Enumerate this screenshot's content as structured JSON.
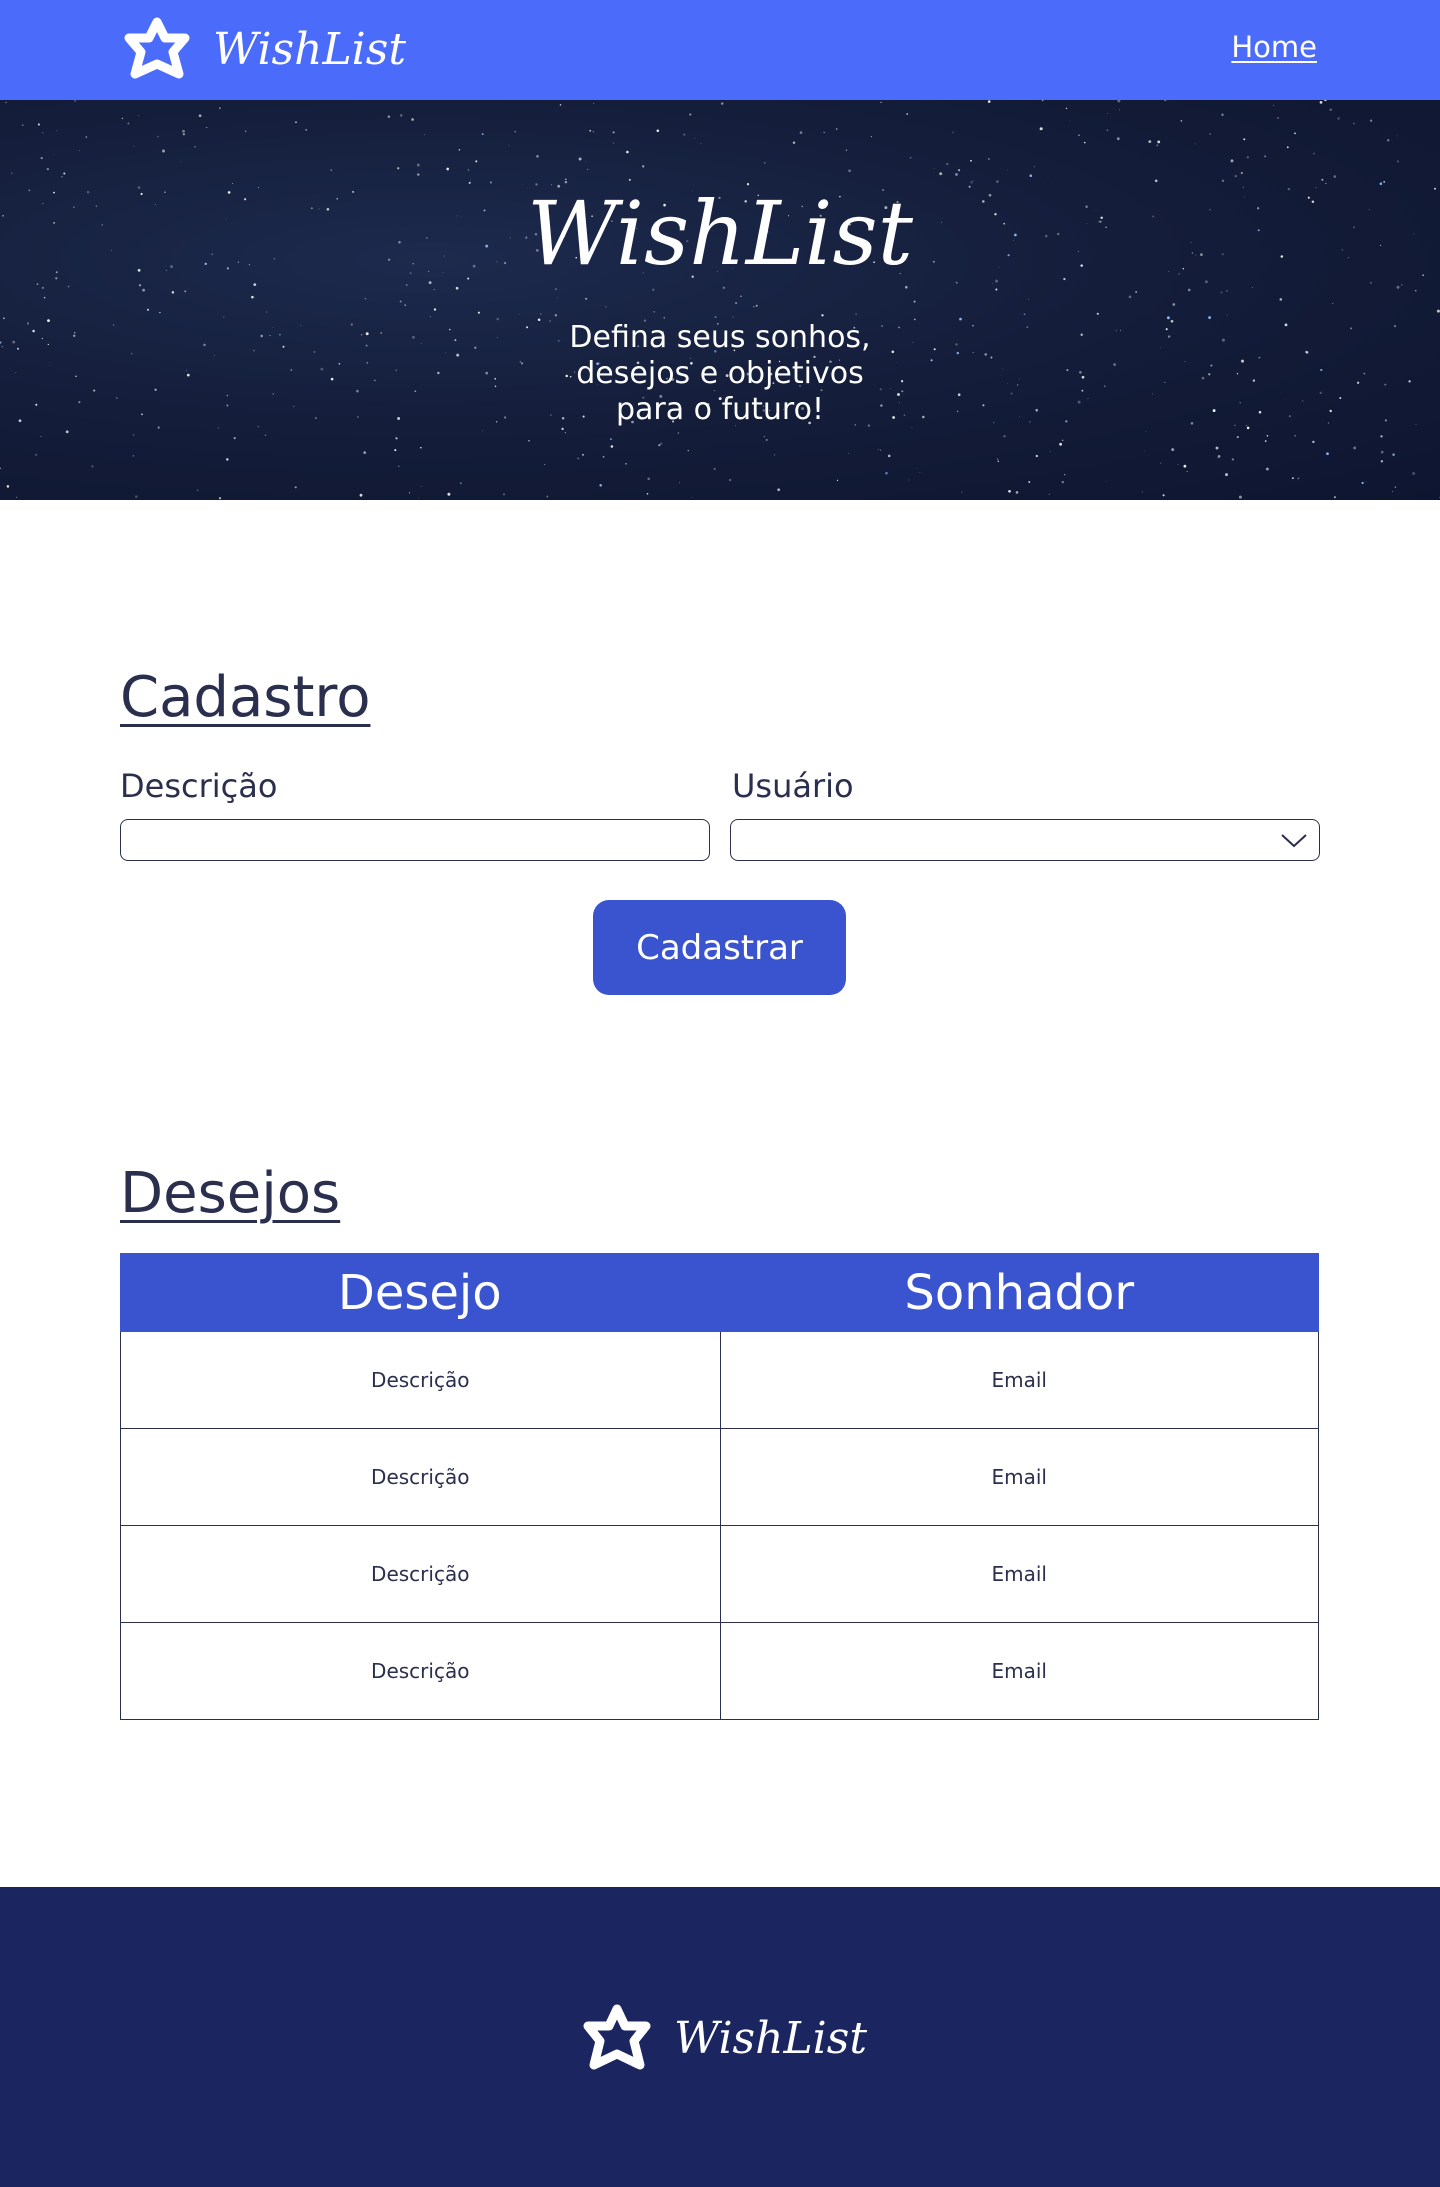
{
  "header": {
    "brand": "WishList",
    "nav_home": "Home"
  },
  "hero": {
    "title": "WishList",
    "subtitle_lines": [
      "Defina seus sonhos,",
      "desejos e objetivos",
      "para o futuro!"
    ]
  },
  "cadastro": {
    "title": "Cadastro",
    "descricao_label": "Descrição",
    "descricao_value": "",
    "usuario_label": "Usuário",
    "usuario_value": "",
    "submit_label": "Cadastrar"
  },
  "desejos": {
    "title": "Desejos",
    "columns": [
      "Desejo",
      "Sonhador"
    ],
    "rows": [
      [
        "Descrição",
        "Email"
      ],
      [
        "Descrição",
        "Email"
      ],
      [
        "Descrição",
        "Email"
      ],
      [
        "Descrição",
        "Email"
      ]
    ]
  },
  "footer": {
    "brand": "WishList"
  },
  "colors": {
    "header_bg": "#4b6bfb",
    "button_bg": "#3a54cf",
    "footer_bg": "#1b2560",
    "text": "#2b2f4e"
  }
}
